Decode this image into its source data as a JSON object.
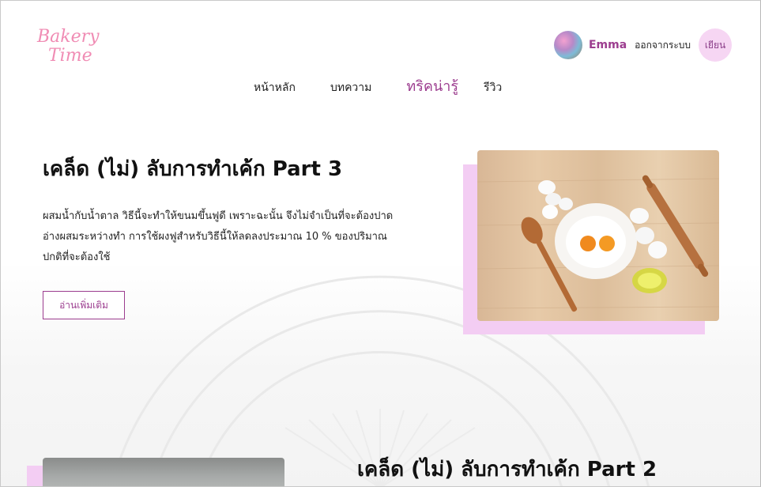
{
  "logo": {
    "line1": "Bakery",
    "line2": "Time"
  },
  "user": {
    "name": "Emma",
    "logout_label": "ออกจากระบบ",
    "guest_label": "เยียน"
  },
  "nav": {
    "items": [
      {
        "label": "หน้าหลัก"
      },
      {
        "label": "บทความ"
      },
      {
        "label": "ทริคน่ารู้"
      },
      {
        "label": "รีวิว"
      }
    ]
  },
  "articles": [
    {
      "title": "เคล็ด (ไม่) ลับการทำเค้ก Part 3",
      "body": "ผสมน้ำกับน้ำตาล วิธีนี้จะทำให้ขนมขึ้นฟูดี เพราะฉะนั้น จึงไม่จำเป็นที่จะต้องปาดอ่างผสมระหว่างทำ การใช้ผงฟูสำหรับวิธีนี้ให้ลดลงประมาณ 10 % ของปริมาณปกติที่จะต้องใช้",
      "read_more_label": "อ่านเพิ่มเติม"
    },
    {
      "title": "เคล็ด (ไม่) ลับการทำเค้ก Part 2"
    }
  ],
  "colors": {
    "brand_pink": "#f08cb4",
    "accent_purple": "#9c3d8f",
    "image_backdrop": "#f3cdf3"
  }
}
